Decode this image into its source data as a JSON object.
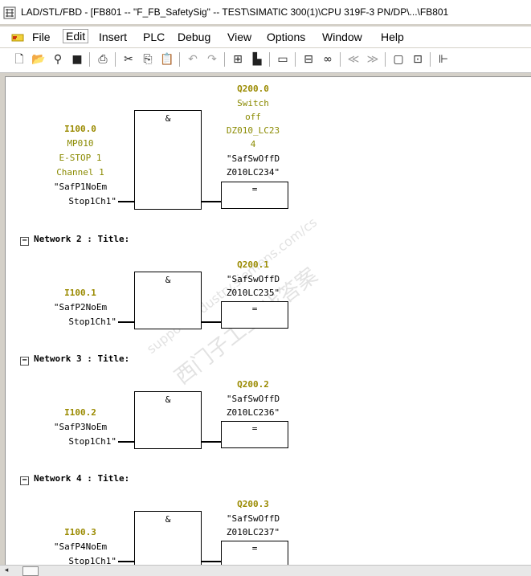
{
  "window": {
    "title": "LAD/STL/FBD  - [FB801 -- \"F_FB_SafetySig\" -- TEST\\SIMATIC 300(1)\\CPU 319F-3 PN/DP\\...\\FB801"
  },
  "menu": {
    "items": [
      {
        "label": "File"
      },
      {
        "label": "Edit"
      },
      {
        "label": "Insert"
      },
      {
        "label": "PLC"
      },
      {
        "label": "Debug"
      },
      {
        "label": "View"
      },
      {
        "label": "Options"
      },
      {
        "label": "Window"
      },
      {
        "label": "Help"
      }
    ]
  },
  "toolbar": {
    "icons": [
      "new-icon",
      "open-icon",
      "accessible-nodes-icon",
      "save-icon",
      "print-icon",
      "cut-icon",
      "copy-icon",
      "paste-icon",
      "undo-icon",
      "redo-icon",
      "load-icon",
      "download-icon",
      "overview-icon",
      "network-icon",
      "monitor-icon",
      "first-icon",
      "last-icon",
      "window-icon",
      "zoom-icon",
      "ladder-icon"
    ]
  },
  "network1": {
    "input_address": "I100.0",
    "input_comment": [
      "MP010",
      "E-STOP 1",
      "Channel 1"
    ],
    "input_symbol": [
      "\"SafP1NoEm",
      "Stop1Ch1\""
    ],
    "and_label": "&",
    "output_address": "Q200.0",
    "output_comment": [
      "Switch",
      "off",
      "DZ010_LC23",
      "4"
    ],
    "output_symbol": [
      "\"SafSwOffD",
      "Z010LC234\""
    ],
    "assign_label": "="
  },
  "networks": [
    {
      "header": "Network 2 : Title:",
      "input_address": "I100.1",
      "input_symbol": [
        "\"SafP2NoEm",
        "Stop1Ch1\""
      ],
      "and_label": "&",
      "output_address": "Q200.1",
      "output_symbol": [
        "\"SafSwOffD",
        "Z010LC235\""
      ],
      "assign_label": "="
    },
    {
      "header": "Network 3 : Title:",
      "input_address": "I100.2",
      "input_symbol": [
        "\"SafP3NoEm",
        "Stop1Ch1\""
      ],
      "and_label": "&",
      "output_address": "Q200.2",
      "output_symbol": [
        "\"SafSwOffD",
        "Z010LC236\""
      ],
      "assign_label": "="
    },
    {
      "header": "Network 4 : Title:",
      "input_address": "I100.3",
      "input_symbol": [
        "\"SafP4NoEm",
        "Stop1Ch1\""
      ],
      "and_label": "&",
      "output_address": "Q200.3",
      "output_symbol": [
        "\"SafSwOffD",
        "Z010LC237\""
      ],
      "assign_label": "="
    }
  ],
  "watermark": {
    "line1": "西门子工业  找答案",
    "line2": "support.industry.siemens.com/cs"
  },
  "colors": {
    "address": "#9a8a00",
    "comment": "#8a8a00",
    "background": "#ffffff"
  }
}
